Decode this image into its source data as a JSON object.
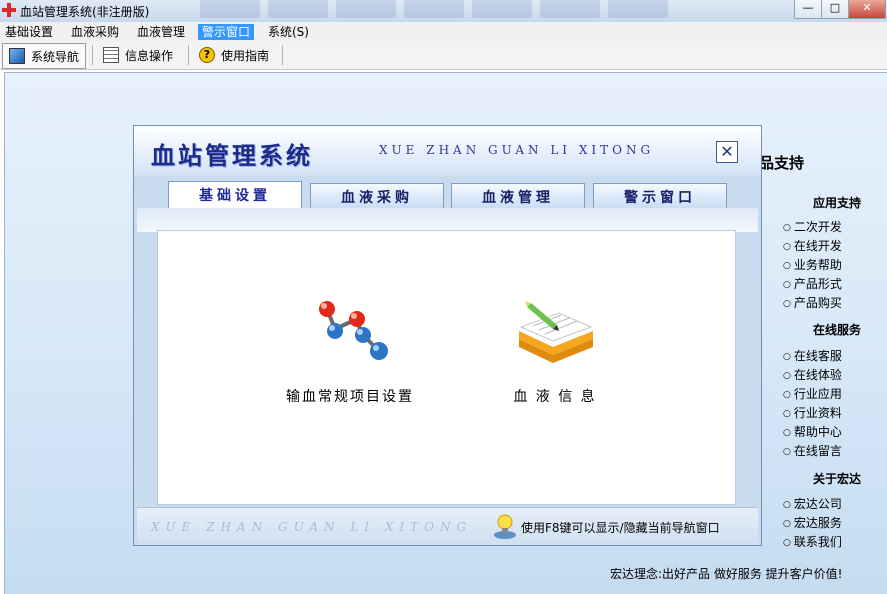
{
  "window": {
    "title": "血站管理系统(非注册版)",
    "minimize_glyph": "—",
    "maximize_glyph": "□",
    "close_glyph": "✕"
  },
  "menubar": {
    "items": [
      "基础设置",
      "血液采购",
      "血液管理",
      "警示窗口",
      "系统(S)"
    ],
    "active_index": 3
  },
  "toolbar": {
    "items": [
      {
        "label": "系统导航",
        "icon": "monitor-icon",
        "pressed": true
      },
      {
        "label": "信息操作",
        "icon": "grid-icon"
      },
      {
        "label": "使用指南",
        "icon": "help-icon"
      }
    ]
  },
  "right_panel": {
    "header": "品支持",
    "sections": [
      {
        "title": "应用支持",
        "links": [
          "二次开发",
          "在线开发",
          "业务帮助",
          "产品形式",
          "产品购买"
        ]
      },
      {
        "title": "在线服务",
        "links": [
          "在线客服",
          "在线体验",
          "行业应用",
          "行业资料",
          "帮助中心",
          "在线留言"
        ]
      },
      {
        "title": "关于宏达",
        "links": [
          "宏达公司",
          "宏达服务",
          "联系我们"
        ]
      }
    ],
    "motto": "宏达理念:出好产品 做好服务 提升客户价值!"
  },
  "dialog": {
    "title": "血站管理系统",
    "pinyin": "XUE ZHAN GUAN LI XITONG",
    "close_glyph": "✕",
    "tabs": [
      "基础设置",
      "血液采购",
      "血液管理",
      "警示窗口"
    ],
    "active_tab": 0,
    "features": [
      {
        "label": "输血常规项目设置",
        "icon": "molecule-icon"
      },
      {
        "label": "血 液 信 息",
        "icon": "notebook-icon"
      }
    ],
    "footer_pinyin": "XUE ZHAN GUAN LI XITONG",
    "footer_hint": "使用F8键可以显示/隐藏当前导航窗口"
  },
  "colors": {
    "menu_active": "#3399ff",
    "dialog_title": "#1c2a8a"
  }
}
